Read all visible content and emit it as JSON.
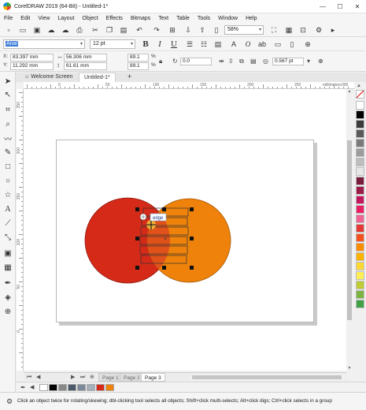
{
  "window": {
    "title": "CorelDRAW 2019 (64-Bit) - Untitled-1*",
    "minimize": "—",
    "maximize": "☐",
    "close": "✕"
  },
  "menus": [
    "File",
    "Edit",
    "View",
    "Layout",
    "Object",
    "Effects",
    "Bitmaps",
    "Text",
    "Table",
    "Tools",
    "Window",
    "Help"
  ],
  "toolbar": {
    "zoom": "58%",
    "icons": [
      "new-icon",
      "open-icon",
      "save-icon",
      "cloud-download-icon",
      "cloud-upload-icon",
      "print-icon",
      "cut-icon",
      "copy-icon",
      "paste-icon",
      "undo-icon",
      "redo-icon",
      "search-content-icon",
      "import-icon",
      "export-icon",
      "pdf-icon",
      "zoom-dropdown",
      "full-screen-icon",
      "rulers-icon",
      "snap-icon",
      "settings-icon",
      "launch-icon"
    ]
  },
  "property_bar": {
    "font_name": "Arial",
    "font_size": "12 pt",
    "bold": "B",
    "italic": "I",
    "underline": "U",
    "x_label": "X:",
    "x_value": "83.397 mm",
    "y_label": "Y:",
    "y_value": "11.292 mm",
    "w_value": "56.306 mm",
    "h_value": "61.61 mm",
    "scale_x": "89.1",
    "scale_y": "89.1",
    "percent": "%",
    "rotation": "0.0",
    "outline": "0.567 pt"
  },
  "tabs": [
    {
      "label": "Welcome Screen"
    },
    {
      "label": "Untitled-1*"
    }
  ],
  "ruler": {
    "h_labels": [
      "0",
      "50",
      "100",
      "150",
      "200",
      "250",
      "300",
      "millimeters"
    ],
    "v_labels": [
      "250",
      "200",
      "150",
      "100",
      "50",
      "0"
    ]
  },
  "canvas": {
    "tooltip": "edge",
    "left_circle_color": "#d62a18",
    "right_circle_color": "#ee820a",
    "overlap_color": "#e0521a"
  },
  "pages": {
    "tabs": [
      "Page 1",
      "Page 2",
      "Page 3"
    ],
    "nav": [
      "⏮",
      "◀",
      "◀",
      "▶",
      "▶",
      "⏭"
    ]
  },
  "palette": [
    "#ffffff",
    "#000000",
    "#3c3c3c",
    "#5a5a5a",
    "#7a7a7a",
    "#9c9c9c",
    "#bdbdbd",
    "#e6e6e6",
    "#7a1d3c",
    "#9c1d4a",
    "#c2185b",
    "#e91e63",
    "#f06292",
    "#e53935",
    "#f4511e",
    "#fb8c00",
    "#ffb300",
    "#fdd835",
    "#ffee58",
    "#c0ca33",
    "#7cb342",
    "#43a047"
  ],
  "document_palette": [
    "#ffffff",
    "#000000",
    "#888888",
    "#4a5a6a",
    "#7a8a9a",
    "#a4b0bc",
    "#d62a18",
    "#ee820a"
  ],
  "status": {
    "text": "Click an object twice for rotating/skewing; dbl-clicking tool selects all objects; Shift+click multi-selects; Alt+click digs; Ctrl+click selects in a group"
  }
}
